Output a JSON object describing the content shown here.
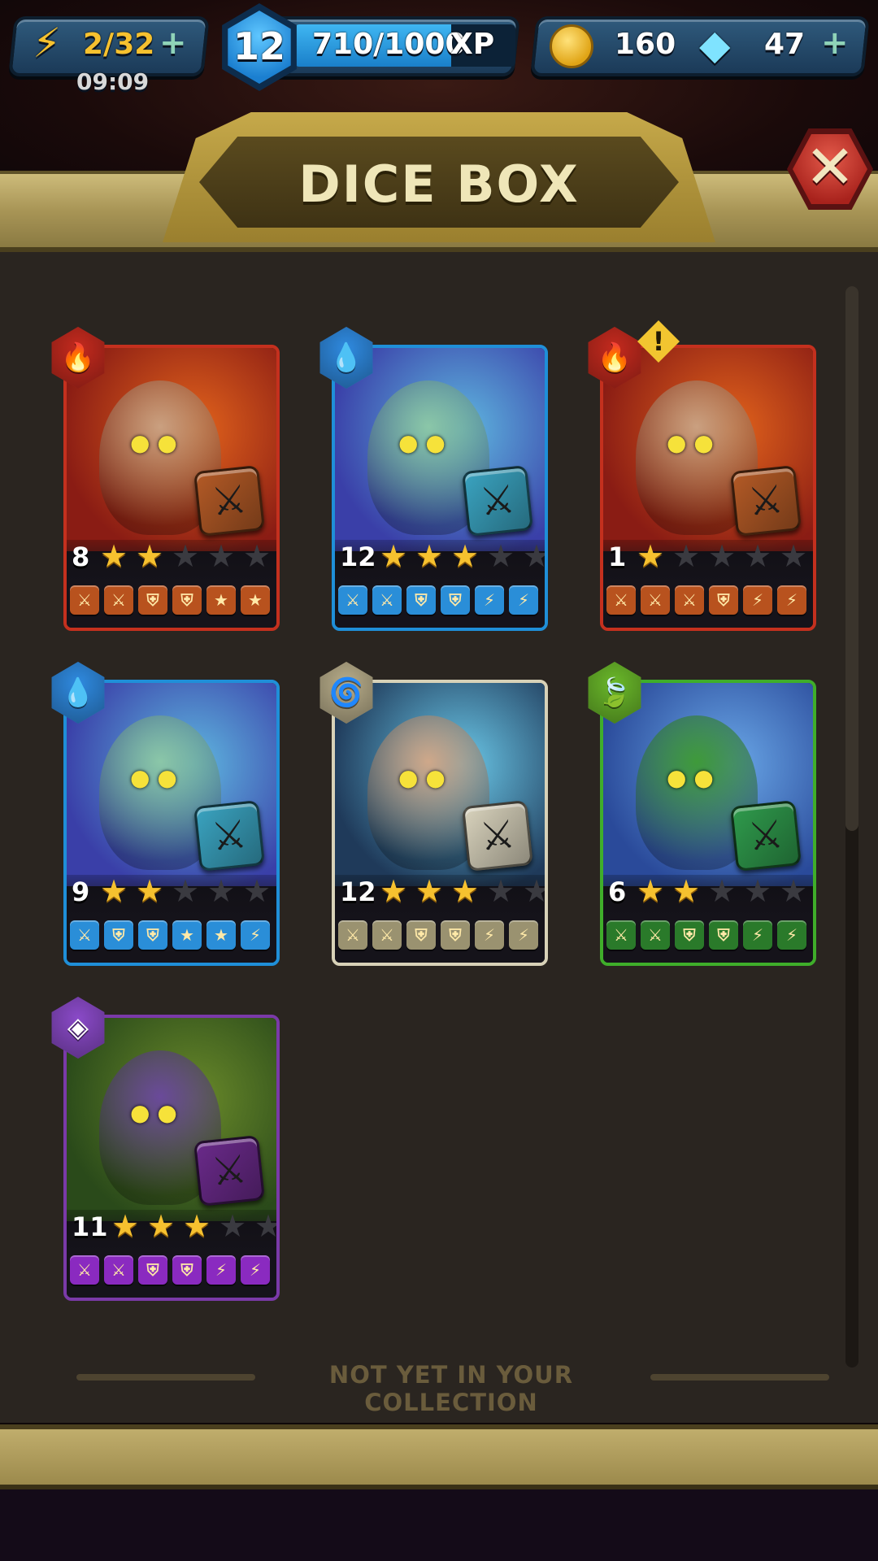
{
  "hud": {
    "energy": "2/32",
    "energy_timer": "09:09",
    "level": "12",
    "xp": "710/1000",
    "xp_suffix": "XP",
    "xp_progress": 0.71,
    "coins": "160",
    "gems": "47",
    "plus_label": "+"
  },
  "header": {
    "title": "DICE BOX",
    "close_symbol": "✕"
  },
  "cards": [
    {
      "level": "8",
      "stars": 2,
      "max_stars": 5,
      "element": "fire-icon",
      "element_glyph": "🔥",
      "theme": "red",
      "alert": false,
      "faces": [
        "⚔",
        "⚔",
        "⛨",
        "⛨",
        "★",
        "★"
      ]
    },
    {
      "level": "12",
      "stars": 3,
      "max_stars": 5,
      "element": "water-icon",
      "element_glyph": "💧",
      "theme": "blue",
      "alert": false,
      "faces": [
        "⚔",
        "⚔",
        "⛨",
        "⛨",
        "⚡",
        "⚡"
      ]
    },
    {
      "level": "1",
      "stars": 1,
      "max_stars": 5,
      "element": "fire-icon",
      "element_glyph": "🔥",
      "theme": "red",
      "alert": true,
      "faces": [
        "⚔",
        "⚔",
        "⚔",
        "⛨",
        "⚡",
        "⚡"
      ]
    },
    {
      "level": "9",
      "stars": 2,
      "max_stars": 5,
      "element": "water-icon",
      "element_glyph": "💧",
      "theme": "blue",
      "alert": false,
      "faces": [
        "⚔",
        "⛨",
        "⛨",
        "★",
        "★",
        "⚡"
      ]
    },
    {
      "level": "12",
      "stars": 3,
      "max_stars": 5,
      "element": "air-icon",
      "element_glyph": "🌀",
      "theme": "silver",
      "alert": false,
      "faces": [
        "⚔",
        "⚔",
        "⛨",
        "⛨",
        "⚡",
        "⚡"
      ]
    },
    {
      "level": "6",
      "stars": 2,
      "max_stars": 5,
      "element": "nature-icon",
      "element_glyph": "🍃",
      "theme": "green",
      "alert": false,
      "faces": [
        "⚔",
        "⚔",
        "⛨",
        "⛨",
        "⚡",
        "⚡"
      ]
    },
    {
      "level": "11",
      "stars": 3,
      "max_stars": 5,
      "element": "arcane-icon",
      "element_glyph": "◈",
      "theme": "purple",
      "alert": false,
      "faces": [
        "⚔",
        "⚔",
        "⛨",
        "⛨",
        "⚡",
        "⚡"
      ]
    }
  ],
  "themes": {
    "red": {
      "border": "#c4301e",
      "art": "#8a1c14",
      "art2": "#e3641c",
      "dice": "#b35a26",
      "face": "#b8521e",
      "hex": "#c42a1e",
      "monster": "#caa080"
    },
    "blue": {
      "border": "#1f8fd8",
      "art": "#3a3fa8",
      "art2": "#5fb8e0",
      "dice": "#3aa3c0",
      "face": "#2a8ed8",
      "hex": "#2f8ae0",
      "monster": "#8bc7a8"
    },
    "silver": {
      "border": "#d8d2b8",
      "art": "#1f3a5a",
      "art2": "#6bc8e8",
      "dice": "#d8d2bc",
      "face": "#9a9270",
      "hex": "#b8ad8a",
      "monster": "#cfa88a"
    },
    "green": {
      "border": "#3fae2a",
      "art": "#2a4a9a",
      "art2": "#6aa8e8",
      "dice": "#2f9a4c",
      "face": "#2a7a2a",
      "hex": "#6ab82a",
      "monster": "#3f9a3a"
    },
    "purple": {
      "border": "#7a3aa8",
      "art": "#2a4a1a",
      "art2": "#6a8a2a",
      "dice": "#6a2a8a",
      "face": "#8a2ac0",
      "hex": "#8a4ac8",
      "monster": "#6a4a9a"
    }
  },
  "footer": {
    "not_in_collection": "NOT YET IN YOUR COLLECTION"
  }
}
